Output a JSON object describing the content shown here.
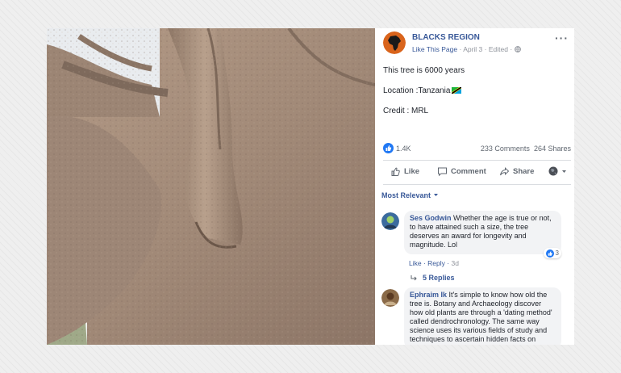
{
  "post": {
    "page_name": "BLACKS REGION",
    "like_page": "Like This Page",
    "date": "April 3",
    "edited": "Edited",
    "lines": [
      "This tree is 6000 years",
      "Location :Tanzania",
      "Credit : MRL"
    ],
    "reaction_count": "1.4K",
    "comments_count": "233 Comments",
    "shares_count": "264 Shares"
  },
  "actions": {
    "like": "Like",
    "comment": "Comment",
    "share": "Share"
  },
  "sort_label": "Most Relevant",
  "comments": [
    {
      "author": "Ses Godwin",
      "text": "Whether the age is true or not, to have attained such a size, the tree deserves an award for longevity and magnitude. Lol",
      "like": "Like",
      "reply": "Reply",
      "time": "3d",
      "reactions": "3",
      "replies": "5 Replies"
    },
    {
      "author": "Ephraim Ik",
      "text": "It's simple to know how old the tree is. Botany and Archaeology discover how old plants are through a 'dating method' called dendrochronology. The same way science uses its various fields of study and techniques to ascertain hidden facts on"
    }
  ],
  "colors": {
    "link": "#385898",
    "muted": "#90949c",
    "like_blue": "#2078f4",
    "bubble_bg": "#f2f3f5"
  },
  "icons": [
    "africa-map-avatar-icon",
    "globe-icon",
    "more-icon",
    "tanzania-flag-icon",
    "like-reaction-icon",
    "thumbs-up-icon",
    "comment-icon",
    "share-icon",
    "audience-icon",
    "dropdown-caret-icon",
    "reply-arrow-icon"
  ]
}
